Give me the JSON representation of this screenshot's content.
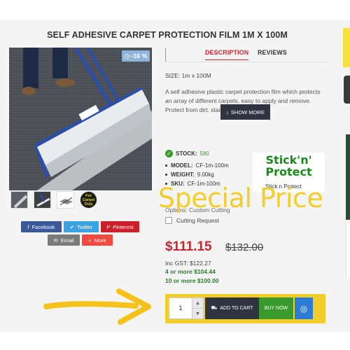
{
  "product": {
    "title": "SELF ADHESIVE CARPET PROTECTION FILM 1M X 100M",
    "discount_badge": "-16 %",
    "tabs": [
      {
        "label": "DESCRIPTION",
        "active": true
      },
      {
        "label": "REVIEWS",
        "active": false
      }
    ],
    "size_line": "SIZE: 1m x 100M",
    "description": "A self adhesive plastic carpet protection film which protects an array of different carpets, easy to apply and remove. Protect from dirt, stains & spills during",
    "show_more_label": "SHOW MORE",
    "stock_label": "STOCK:",
    "stock_value": "580",
    "specs": [
      {
        "label": "MODEL:",
        "value": "CF-1m-100m"
      },
      {
        "label": "WEIGHT:",
        "value": "9.00kg"
      },
      {
        "label": "SKU:",
        "value": "CF-1m-100m"
      }
    ],
    "brand_logo_line1": "Stick'n'",
    "brand_logo_line2": "Protect",
    "brand_name": "Stick n Protect",
    "options_label": "Options: Custom Cutting",
    "cutting_label": "Cutting Request",
    "special_overlay": "Special Price",
    "price": "$111.15",
    "old_price": "$132.00",
    "inc_gst": "Inc GST: $122.27",
    "tiers": [
      "4 or more $104.44",
      "10 or more $100.00"
    ],
    "quantity": "1",
    "add_to_cart_label": "ADD TO CART",
    "buy_now_label": "BUY NOW"
  },
  "thumbnails": {
    "carpet_only_text": "For Carpet Only"
  },
  "share": {
    "facebook": "Facebook",
    "twitter": "Twitter",
    "pinterest": "Pinterest",
    "email": "Email",
    "more": "More"
  },
  "colors": {
    "accent_red": "#c8262b",
    "stock_green": "#3a9a2e",
    "overlay_yellow": "#f4cd2a",
    "button_dark": "#2f3440"
  }
}
